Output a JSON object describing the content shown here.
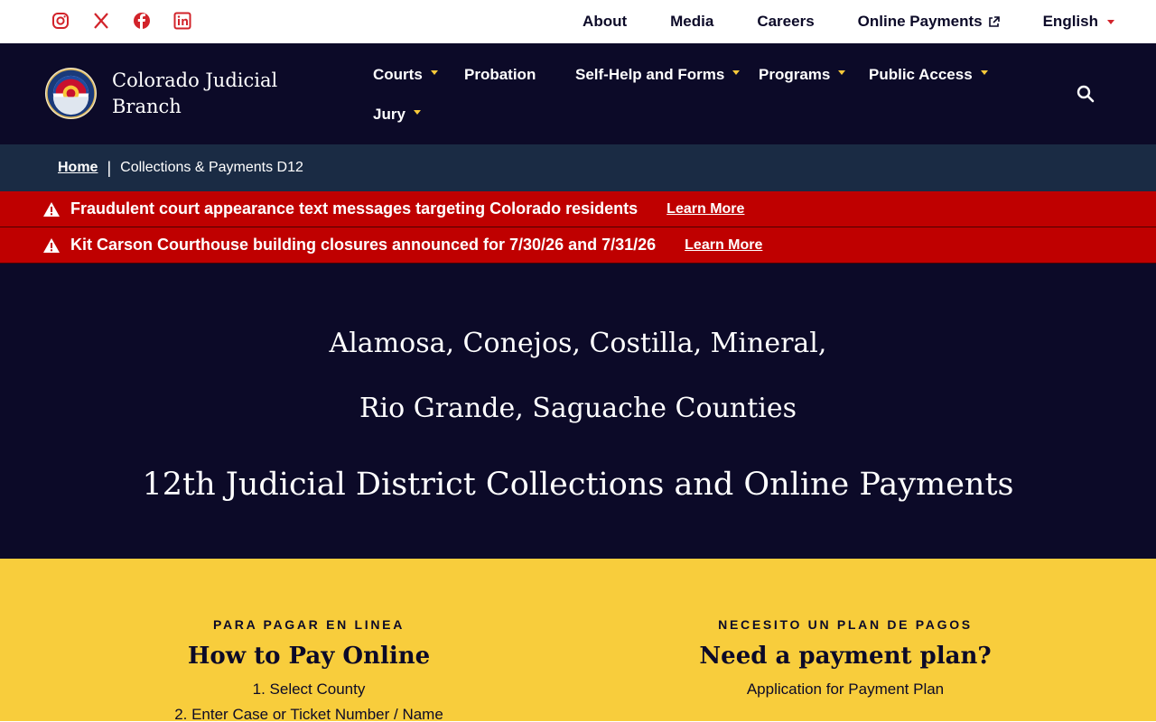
{
  "colors": {
    "navy": "#0c0a28",
    "crumb_bg": "#1a2b44",
    "alert_red": "#bf0000",
    "gold": "#f8c93a",
    "social_red": "#d2232a",
    "yellow_bg": "#f8cd3c"
  },
  "social": [
    "instagram-icon",
    "x-icon",
    "facebook-icon",
    "linkedin-icon"
  ],
  "utility_nav": {
    "about": "About",
    "media": "Media",
    "careers": "Careers",
    "payments": "Online Payments",
    "language": "English"
  },
  "brand": {
    "line1": "Colorado Judicial",
    "line2": "Branch"
  },
  "main_nav": {
    "courts": "Courts",
    "probation": "Probation",
    "self_help": "Self-Help and Forms",
    "programs": "Programs",
    "public_access": "Public Access",
    "jury": "Jury"
  },
  "breadcrumb": {
    "home": "Home",
    "current": "Collections & Payments D12"
  },
  "alerts": [
    {
      "message": "Fraudulent court appearance text messages targeting Colorado residents",
      "link": "Learn More"
    },
    {
      "message": "Kit Carson Courthouse building closures announced for 7/30/26 and 7/31/26",
      "link": "Learn More"
    }
  ],
  "hero": {
    "counties_line1": "Alamosa, Conejos, Costilla, Mineral,",
    "counties_line2": "Rio Grande, Saguache Counties",
    "headline": "12th Judicial District Collections and Online Payments"
  },
  "pay_online": {
    "eyebrow": "PARA PAGAR EN LINEA",
    "title": "How to Pay Online",
    "steps": [
      "1. Select County",
      "2. Enter Case or Ticket Number / Name"
    ]
  },
  "payment_plan": {
    "eyebrow": "NECESITO UN PLAN DE PAGOS",
    "title": "Need a payment plan?",
    "link": "Application for Payment Plan"
  }
}
